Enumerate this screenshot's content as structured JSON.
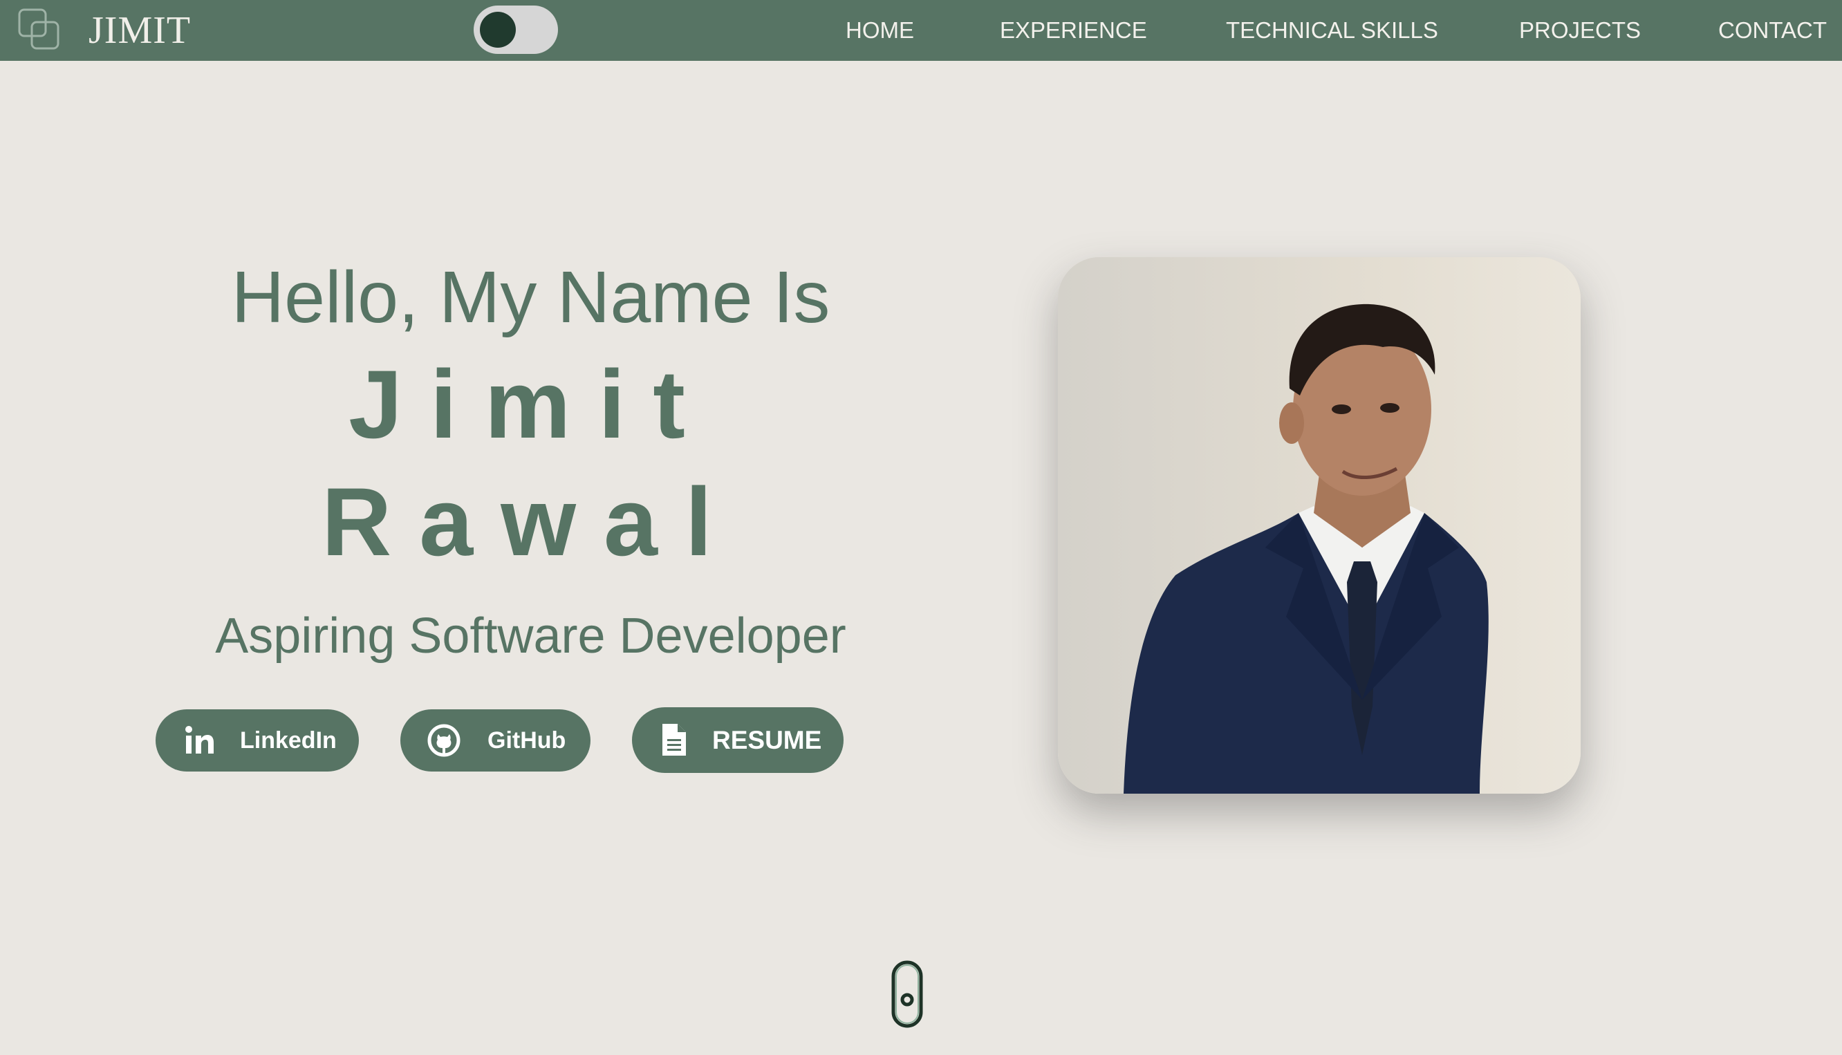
{
  "brand": {
    "name": "JIMIT"
  },
  "nav": {
    "home": "HOME",
    "experience": "EXPERIENCE",
    "skills": "TECHNICAL SKILLS",
    "projects": "PROJECTS",
    "contact": "CONTACT"
  },
  "theme_toggle": {
    "state": "dark"
  },
  "hero": {
    "greeting": "Hello, My Name Is",
    "first_name": "Jimit",
    "last_name": "Rawal",
    "tagline": "Aspiring Software Developer"
  },
  "buttons": {
    "linkedin": "LinkedIn",
    "github": "GitHub",
    "resume": "RESUME"
  },
  "icons": {
    "logo": "overlapping-squares-icon",
    "linkedin": "linkedin-icon",
    "github": "github-icon",
    "resume": "document-icon",
    "scroll": "scroll-mouse-icon"
  },
  "colors": {
    "accent": "#577464",
    "background": "#eae7e2",
    "nav_text": "#f3f1ec",
    "toggle_knob": "#203a2e"
  }
}
